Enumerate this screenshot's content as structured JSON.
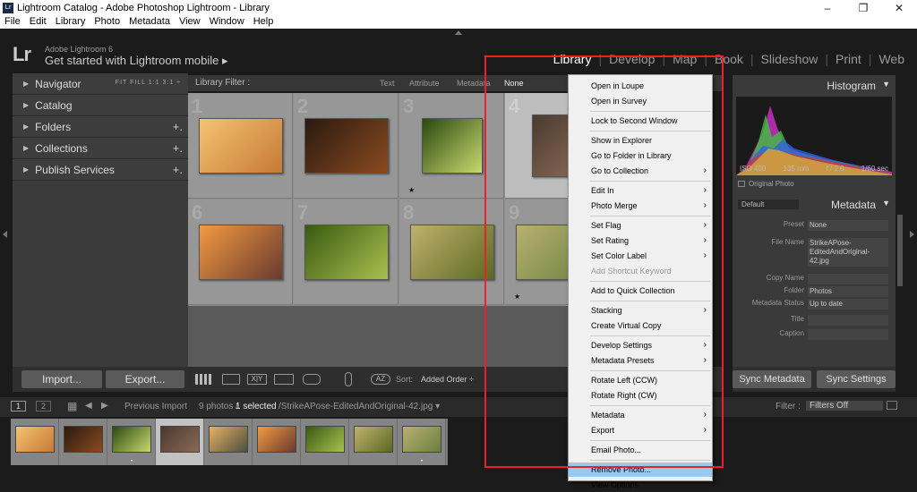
{
  "window": {
    "title": "Lightroom Catalog - Adobe Photoshop Lightroom - Library",
    "icon_text": "Lr"
  },
  "menubar": [
    "File",
    "Edit",
    "Library",
    "Photo",
    "Metadata",
    "View",
    "Window",
    "Help"
  ],
  "identity": {
    "logo": "Lr",
    "brand": "Adobe Lightroom 6",
    "plate": "Get started with Lightroom mobile ▸"
  },
  "modules": [
    {
      "label": "Library",
      "active": true
    },
    {
      "label": "Develop"
    },
    {
      "label": "Map"
    },
    {
      "label": "Book"
    },
    {
      "label": "Slideshow"
    },
    {
      "label": "Print"
    },
    {
      "label": "Web"
    }
  ],
  "left_panel": {
    "navigator": {
      "label": "Navigator",
      "zoom": "FIT  FILL  1:1  3:1 ÷"
    },
    "sections": [
      {
        "label": "Catalog",
        "plus": ""
      },
      {
        "label": "Folders",
        "plus": "+."
      },
      {
        "label": "Collections",
        "plus": "+."
      },
      {
        "label": "Publish Services",
        "plus": "+."
      }
    ],
    "import_label": "Import...",
    "export_label": "Export..."
  },
  "filter_bar": {
    "label": "Library Filter :",
    "options": [
      "Text",
      "Attribute",
      "Metadata",
      "None"
    ]
  },
  "grid": {
    "cells": [
      {
        "num": "1",
        "colors": [
          "#f4c272",
          "#c67a35"
        ],
        "star": ""
      },
      {
        "num": "2",
        "colors": [
          "#2a1a10",
          "#8a4a20"
        ],
        "star": ""
      },
      {
        "num": "3",
        "colors": [
          "#2c4a10",
          "#c8d870"
        ],
        "star": "★"
      },
      {
        "num": "4",
        "colors": [
          "#4a3a30",
          "#8a6a55"
        ],
        "star": ""
      },
      {
        "num": "6",
        "colors": [
          "#f29a40",
          "#6a3a30"
        ],
        "star": ""
      },
      {
        "num": "7",
        "colors": [
          "#3a5a12",
          "#a8c050"
        ],
        "star": ""
      },
      {
        "num": "8",
        "colors": [
          "#c0b070",
          "#5a6a20"
        ],
        "star": ""
      },
      {
        "num": "9",
        "colors": [
          "#b8b070",
          "#6a8040"
        ],
        "star": "★"
      }
    ]
  },
  "toolbar": {
    "sort_label": "Sort:",
    "sort_value": "Added Order ÷"
  },
  "right_panel": {
    "histogram_label": "Histogram",
    "hist_meta": [
      "ISO 400",
      "135 mm",
      "f / 2.0",
      "1/60 sec"
    ],
    "original_photo": "Original Photo",
    "metadata_label": "Metadata",
    "preset_default": "Default",
    "rows": [
      {
        "k": "Preset",
        "v": "None"
      },
      {
        "k": "File Name",
        "v": "StrikeAPose-EditedAndOriginal-42.jpg"
      },
      {
        "k": "Copy Name",
        "v": ""
      },
      {
        "k": "Folder",
        "v": "Photos"
      },
      {
        "k": "Metadata Status",
        "v": "Up to date"
      },
      {
        "k": "Title",
        "v": ""
      },
      {
        "k": "Caption",
        "v": ""
      }
    ],
    "sync_metadata": "Sync Metadata",
    "sync_settings": "Sync Settings"
  },
  "filmstrip_bar": {
    "previous": "Previous Import",
    "count": "9 photos /",
    "selected": "1 selected",
    "path": "/StrikeAPose-EditedAndOriginal-42.jpg ▾",
    "filter_label": "Filter :",
    "filter_value": "Filters Off",
    "page1": "1",
    "page2": "2"
  },
  "filmstrip": [
    {
      "c": [
        "#f4c272",
        "#c67a35"
      ],
      "s": ""
    },
    {
      "c": [
        "#2a1a10",
        "#8a4a20"
      ],
      "s": ""
    },
    {
      "c": [
        "#2c4a10",
        "#c8d870"
      ],
      "s": "•"
    },
    {
      "c": [
        "#4a3a30",
        "#8a6a55"
      ],
      "s": ""
    },
    {
      "c": [
        "#e8b060",
        "#4a5040"
      ],
      "s": ""
    },
    {
      "c": [
        "#f29a40",
        "#6a3a30"
      ],
      "s": ""
    },
    {
      "c": [
        "#3a5a12",
        "#a8c050"
      ],
      "s": ""
    },
    {
      "c": [
        "#c0b070",
        "#5a6a20"
      ],
      "s": ""
    },
    {
      "c": [
        "#b8b070",
        "#6a8040"
      ],
      "s": "•"
    }
  ],
  "context_menu": {
    "items": [
      {
        "label": "Open in Loupe"
      },
      {
        "label": "Open in Survey"
      },
      {
        "sep": true
      },
      {
        "label": "Lock to Second Window"
      },
      {
        "sep": true
      },
      {
        "label": "Show in Explorer"
      },
      {
        "label": "Go to Folder in Library"
      },
      {
        "label": "Go to Collection",
        "sub": true
      },
      {
        "sep": true
      },
      {
        "label": "Edit In",
        "sub": true
      },
      {
        "label": "Photo Merge",
        "sub": true
      },
      {
        "sep": true
      },
      {
        "label": "Set Flag",
        "sub": true
      },
      {
        "label": "Set Rating",
        "sub": true
      },
      {
        "label": "Set Color Label",
        "sub": true
      },
      {
        "label": "Add Shortcut Keyword",
        "disabled": true
      },
      {
        "sep": true
      },
      {
        "label": "Add to Quick Collection"
      },
      {
        "sep": true
      },
      {
        "label": "Stacking",
        "sub": true
      },
      {
        "label": "Create Virtual Copy"
      },
      {
        "sep": true
      },
      {
        "label": "Develop Settings",
        "sub": true
      },
      {
        "label": "Metadata Presets",
        "sub": true
      },
      {
        "sep": true
      },
      {
        "label": "Rotate Left (CCW)"
      },
      {
        "label": "Rotate Right (CW)"
      },
      {
        "sep": true
      },
      {
        "label": "Metadata",
        "sub": true
      },
      {
        "label": "Export",
        "sub": true
      },
      {
        "sep": true
      },
      {
        "label": "Email Photo..."
      },
      {
        "sep": true
      },
      {
        "label": "Remove Photo...",
        "highlight": true
      },
      {
        "label": "View Options"
      }
    ]
  },
  "colors": {
    "highlight": "#99c9ef",
    "annotation": "#e8222a"
  }
}
